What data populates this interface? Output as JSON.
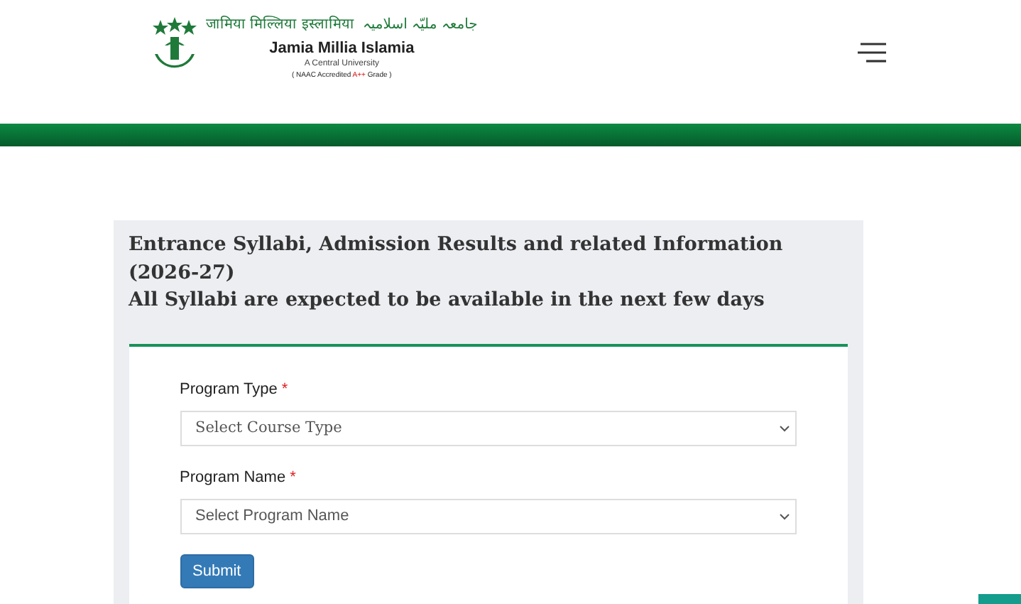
{
  "header": {
    "hindi_name": "जामिया मिल्लिया इस्लामिया",
    "urdu_name": "جامعہ ملیّہ اسلامیہ",
    "english_name": "Jamia Millia Islamia",
    "subtitle": "A Central University",
    "accreditation": [
      {
        "text": "( NAAC Accredited ",
        "highlight": false
      },
      {
        "text": "A++",
        "highlight": true
      },
      {
        "text": " Grade )",
        "highlight": false
      }
    ]
  },
  "notice": {
    "lines": [
      "Entrance Syllabi, Admission Results and related Information (2026-27)",
      "All Syllabi are expected to be available in the next few days"
    ]
  },
  "form": {
    "fields": [
      {
        "label": "Program Type",
        "required_mark": "*",
        "placeholder": "Select Course Type"
      },
      {
        "label": "Program Name",
        "required_mark": "*",
        "placeholder": "Select Program Name"
      }
    ],
    "submit": "Submit"
  }
}
